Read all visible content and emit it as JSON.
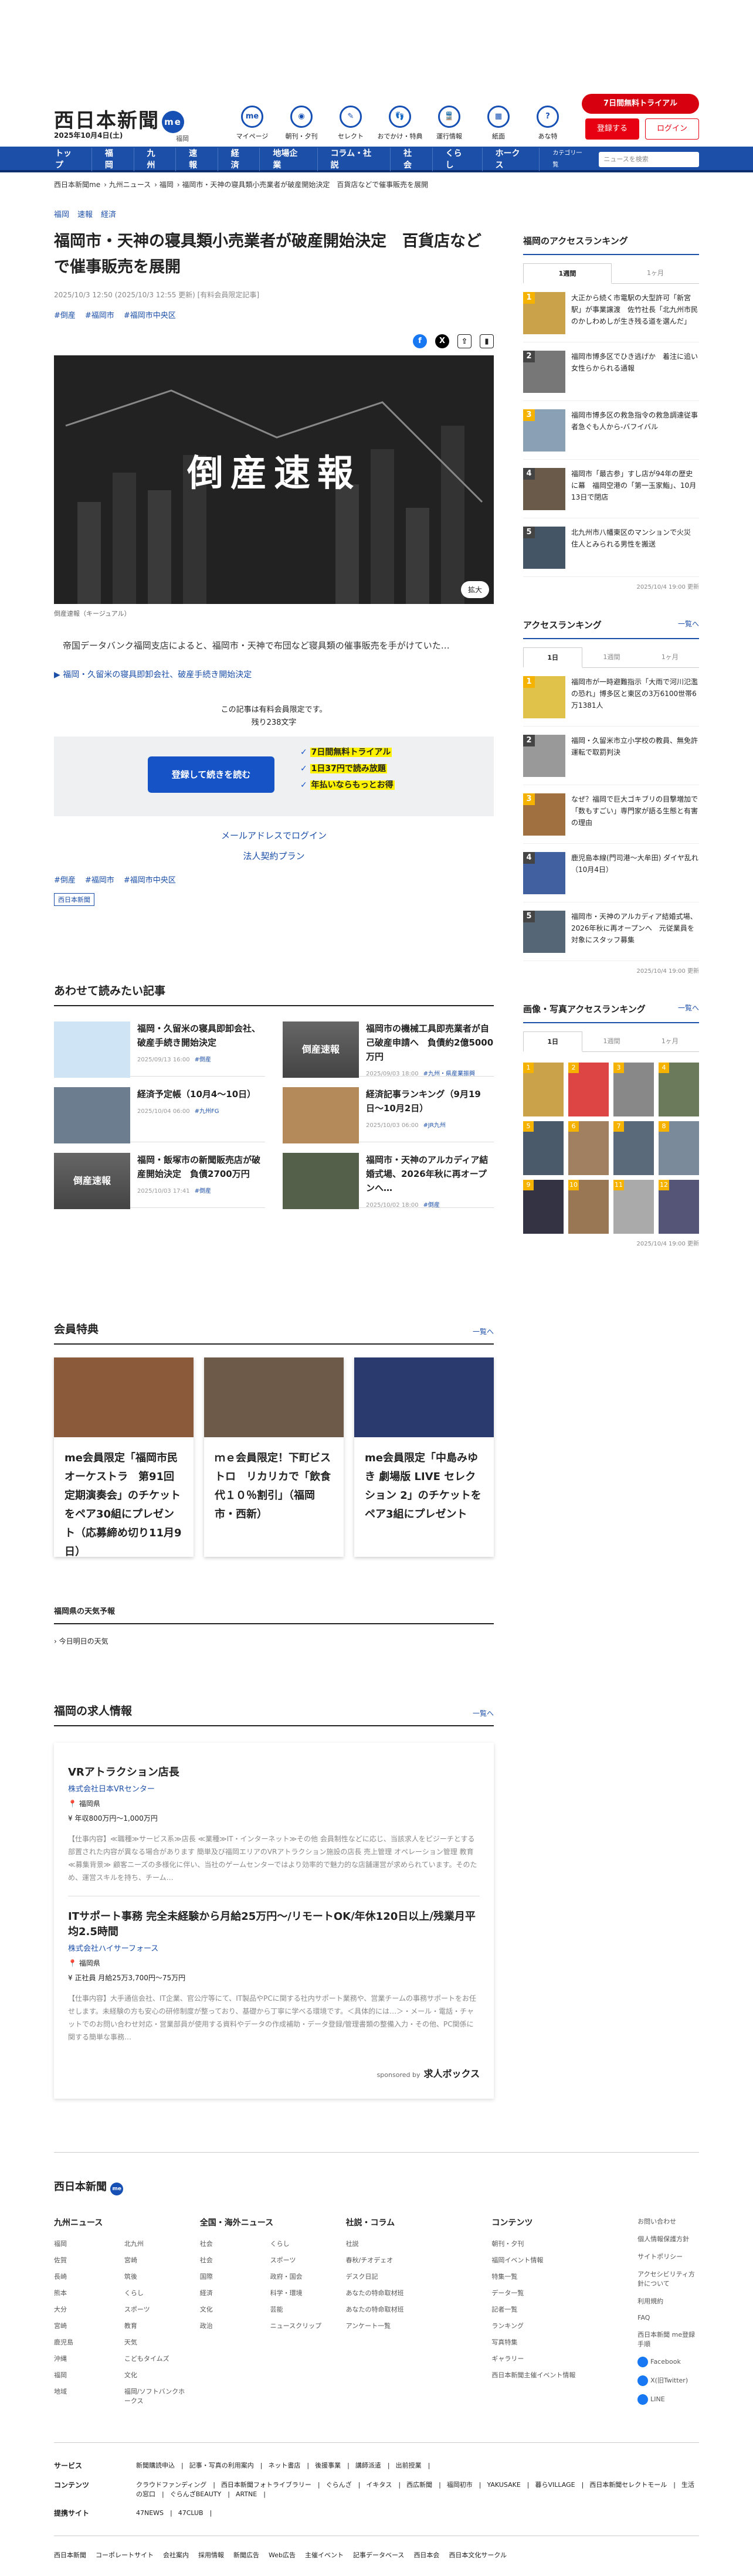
{
  "header": {
    "logo": "西日本新聞",
    "logo_badge": "me",
    "date": "2025年10月4日(土)",
    "region": "福岡",
    "icons": [
      {
        "label": "マイページ",
        "mark": "me"
      },
      {
        "label": "朝刊・夕刊",
        "mark": "◉"
      },
      {
        "label": "セレクト",
        "mark": "✎"
      },
      {
        "label": "おでかけ・特典",
        "mark": "👣"
      },
      {
        "label": "運行情報",
        "mark": "🚆"
      },
      {
        "label": "紙面",
        "mark": "▦"
      },
      {
        "label": "あな特",
        "mark": "?"
      }
    ],
    "trial": "7日間無料トライアル",
    "register": "登録する",
    "login": "ログイン"
  },
  "nav": [
    "トップ",
    "福岡",
    "九州",
    "速報",
    "経済",
    "地場企業",
    "コラム・社説",
    "社会",
    "くらし",
    "ホークス"
  ],
  "nav_category": "カテゴリ一覧",
  "search_placeholder": "ニュースを検索",
  "breadcrumb": [
    "西日本新聞me",
    "九州ニュース",
    "福岡",
    "福岡市・天神の寝具類小売業者が破産開始決定　百貨店などで催事販売を展開"
  ],
  "article": {
    "tags": [
      "福岡",
      "速報",
      "経済"
    ],
    "title": "福岡市・天神の寝具類小売業者が破産開始決定　百貨店などで催事販売を展開",
    "meta": "2025/10/3 12:50 (2025/10/3 12:55 更新) [有料会員限定記事]",
    "keywords": [
      "#倒産",
      "#福岡市",
      "#福岡市中央区"
    ],
    "hero_text": "倒産速報",
    "zoom": "拡大",
    "caption": "倒産速報（キージュアル）",
    "lead": "帝国データバンク福岡支店によると、福岡市・天神で布団など寝具類の催事販売を手がけていた…",
    "related": "福岡・久留米の寝具即卸会社、破産手続き開始決定",
    "paynote": "この記事は有料会員限定です。",
    "remaining": "残り238文字",
    "subscribe": "登録して続きを読む",
    "benefits": [
      "7日間無料トライアル",
      "1日37円で読み放題",
      "年払いならもっとお得"
    ],
    "mail": "メールアドレスでログイン",
    "corp": "法人契約プラン",
    "keywords2": [
      "#倒産",
      "#福岡市",
      "#福岡市中央区"
    ],
    "publisher": "西日本新聞"
  },
  "also": {
    "heading": "あわせて読みたい記事",
    "items": [
      {
        "title": "福岡・久留米の寝具即卸会社、破産手続き開始決定",
        "date": "2025/09/13 16:00",
        "tag": "#倒産",
        "thumb": "map",
        "thumb_text": ""
      },
      {
        "title": "福岡市の機械工具即売業者が自己破産申請へ　負債約2億5000万円",
        "date": "2025/09/03 18:00",
        "tag": "#九州・県産業振興",
        "thumb": "red",
        "thumb_text": "倒産速報"
      },
      {
        "title": "経済予定帳（10月4〜10日）",
        "date": "2025/10/04 06:00",
        "tag": "#九州FG",
        "thumb": "city",
        "thumb_text": ""
      },
      {
        "title": "経済記事ランキング（9月19日〜10月2日）",
        "date": "2025/10/03 06:00",
        "tag": "#JR九州",
        "thumb": "food",
        "thumb_text": ""
      },
      {
        "title": "福岡・飯塚市の新聞販売店が破産開始決定　負債2700万円",
        "date": "2025/10/03 17:41",
        "tag": "#倒産",
        "thumb": "red",
        "thumb_text": "倒産速報"
      },
      {
        "title": "福岡市・天神のアルカディア結婚式場、2026年秋に再オープンへ…",
        "date": "2025/10/02 18:00",
        "tag": "#倒産",
        "thumb": "bldg",
        "thumb_text": ""
      }
    ]
  },
  "benefit": {
    "heading": "会員特典",
    "more": "一覧へ",
    "items": [
      "me会員限定「福岡市民オーケストラ　第91回定期演奏会」のチケットをペア30組にプレゼント（応募締め切り11月9日）",
      "ｍｅ会員限定！下町ビストロ　リカリカで「飲食代１０％割引」（福岡市・西新）",
      "me会員限定「中島みゆき 劇場版 LIVE セレクション 2」のチケットをペア3組にプレゼント"
    ]
  },
  "weather": {
    "heading": "福岡県の天気予報",
    "sub": "今日明日の天気"
  },
  "jobs": {
    "heading": "福岡の求人情報",
    "more": "一覧へ",
    "items": [
      {
        "title": "VRアトラクション店長",
        "company": "株式会社日本VRセンター",
        "place": "福岡県",
        "pay": "年収800万円〜1,000万円",
        "desc": "【仕事内容】≪職種≫サービス系≫店長 ≪業種≫IT・インターネット≫その他 会員制性などに応じ、当該求人をピジーチとする部置された内容が異なる場合があります 簡単及び福岡エリアのVRアトラクション施設の店長 売上管理 オペレーション管理 教育 ≪募集背景≫ 顧客ニーズの多様化に伴い、当社のゲームセンターではより効率的で魅力的な店舗運営が求められています。そのため、運営スキルを持ち、チーム…"
      },
      {
        "title": "ITサポート事務 完全未経験から月給25万円〜/リモートOK/年休120日以上/残業月平均2.5時間",
        "company": "株式会社ハイサーフォース",
        "place": "福岡県",
        "pay": "正社員 月給25万3,700円〜75万円",
        "desc": "【仕事内容】大手通信会社、IT企業、官公庁等にて、IT製品やPCに関する社内サポート業務や、営業チームの事務サポートをお任せします。未経験の方も安心の研修制度が整っており、基礎から丁寧に学べる環境です。＜具体的には…＞・メール・電話・チャットでのお問い合わせ対応・営業部員が使用する資料やデータの作成補助・データ登録/管理書類の整備入力・その他、PC関係に関する簡単な事務…"
      }
    ],
    "sponsor": "sponsored by",
    "sponsor_name": "求人ボックス"
  },
  "side": {
    "access": {
      "heading": "福岡のアクセスランキング",
      "tabs": [
        "1週間",
        "1ヶ月"
      ],
      "items": [
        "大正から続く市電駅の大型許可「新宮駅」が事業譲渡　佐竹社長「北九州市民のかしわめしが生き残る道を選んだ」",
        "福岡市博多区でひき逃げか　着注に追い女性らかられる通報",
        "福岡市博多区の救急指令の救急調達従事者急ぐも人から-バフイバル",
        "福岡市「最古参」すし店が94年の歴史に幕　福岡空港の「第一玉家鮨」、10月13日で閉店",
        "北九州市八幡東区のマンションで火災　住人とみられる男性を搬送"
      ],
      "updated": "2025/10/4 19:00 更新"
    },
    "ranking": {
      "heading": "アクセスランキング",
      "more": "一覧へ",
      "tabs": [
        "1日",
        "1週間",
        "1ヶ月"
      ],
      "items": [
        "福岡市が一時避難指示「大雨で河川氾濫の恐れ」博多区と東区の3万6100世帯6万1381人",
        "福岡・久留米市立小学校の教員、無免許運転で取罰判決",
        "なぜ？福岡で巨大ゴキブリの目撃増加で「数もすごい」専門家が語る生態と有害の理由",
        "鹿児島本線(門司港〜大牟田) ダイヤ乱れ（10月4日）",
        "福岡市・天神のアルカディア結婚式場、2026年秋に再オープンへ　元従業員を対象にスタッフ募集"
      ],
      "updated": "2025/10/4 19:00 更新"
    },
    "photo": {
      "heading": "画像・写真アクセスランキング",
      "more": "一覧へ",
      "tabs": [
        "1日",
        "1週間",
        "1ヶ月"
      ],
      "updated": "2025/10/4 19:00 更新"
    }
  },
  "footer": {
    "logo": "西日本新聞",
    "logo_badge": "me",
    "cols": [
      {
        "h": "九州ニュース",
        "items": [
          "福岡",
          "佐賀",
          "長崎",
          "熊本",
          "大分",
          "宮崎",
          "鹿児島",
          "沖縄",
          "福岡",
          "地域",
          "北九州",
          "宮崎",
          "筑後",
          "くらし",
          "スポーツ",
          "教育",
          "天気",
          "こどもタイムズ",
          "文化",
          "福岡/ソフトバンクホークス"
        ]
      },
      {
        "h": "全国・海外ニュース",
        "items": [
          "社会",
          "社会",
          "国際",
          "経済",
          "文化",
          "政治",
          "くらし",
          "スポーツ",
          "政府・国会",
          "科学・環境",
          "芸能",
          "ニュースクリップ"
        ]
      },
      {
        "h": "社説・コラム",
        "items": [
          "社説",
          "春秋/チオデェオ",
          "デスク日記",
          "あなたの特命取材班",
          "あなたの特命取材班",
          "アンケート一覧"
        ]
      },
      {
        "h": "コンテンツ",
        "items": [
          "朝刊・夕刊",
          "福岡イベント情報",
          "特集一覧",
          "データ一覧",
          "記者一覧",
          "ランキング",
          "写真特集",
          "ギャラリー",
          "西日本新聞主催イベント情報"
        ]
      }
    ],
    "misc": [
      "お問い合わせ",
      "個人情報保護方針",
      "サイトポリシー",
      "アクセシビリティ方針について",
      "利用規約",
      "FAQ",
      "西日本新聞 me登録手順"
    ],
    "sns": [
      "Facebook",
      "X(旧Twitter)",
      "LINE"
    ],
    "rows": [
      {
        "h": "サービス",
        "items": [
          "新聞購読申込",
          "記事・写真の利用案内",
          "ネット書店",
          "後援事業",
          "講師派遣",
          "出前授業"
        ]
      },
      {
        "h": "コンテンツ",
        "items": [
          "クラウドファンディング",
          "西日本新聞フォトライブラリー",
          "ぐらんざ",
          "イキタス",
          "西広新聞",
          "福岡初市",
          "YAKUSAKE",
          "暮らVILLAGE",
          "西日本新聞セレクトモール",
          "生活の窓口",
          "ぐらんざBEAUTY",
          "ARTNE"
        ]
      },
      {
        "h": "提携サイト",
        "items": [
          "47NEWS",
          "47CLUB"
        ]
      }
    ],
    "bottom": [
      "コーポレートサイト",
      "会社案内",
      "採用情報",
      "新聞広告",
      "Web広告",
      "主催イベント",
      "記事データベース",
      "西日本会",
      "西日本文化サークル"
    ]
  }
}
